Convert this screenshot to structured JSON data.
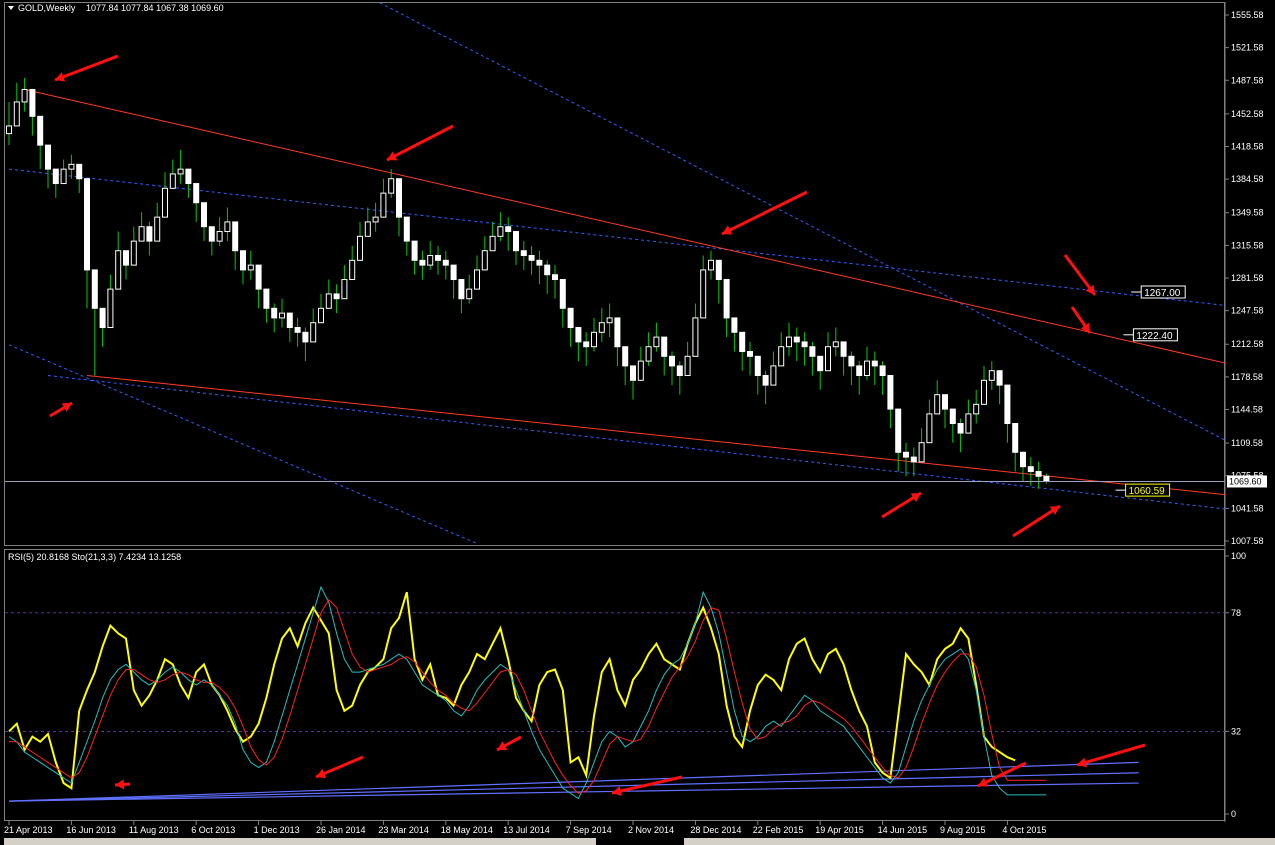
{
  "header": {
    "price_title": "GOLD,Weekly",
    "price_ohlc": "1077.84 1077.84 1067.38 1069.60",
    "osc_title": "RSI(5) 20.8168  Sto(21,3,3) 7.4234 13.1258"
  },
  "colors": {
    "background": "#000000",
    "bull_candle": "#ffffff",
    "bear_candle": "#ffffff",
    "wick": "#00cc00",
    "channel_line": "#ff3b1f",
    "dotted_line": "#3060ff",
    "rsi": "#ffff00",
    "stoch_main": "#20c0c0",
    "stoch_signal": "#ff2020",
    "trend_support": "#6070ff",
    "arrow": "#ff1010",
    "level_line": "#8080ff"
  },
  "chart_data": [
    {
      "type": "candlestick",
      "series_name": "GOLD,Weekly",
      "ylim": [
        1007.58,
        1555.58
      ],
      "y_ticks": [
        "1555.58",
        "1521.58",
        "1487.58",
        "1452.58",
        "1418.58",
        "1384.58",
        "1349.58",
        "1315.58",
        "1281.58",
        "1247.58",
        "1212.58",
        "1178.58",
        "1144.58",
        "1109.58",
        "1075.58",
        "1041.58",
        "1007.58"
      ],
      "y_tick_values": [
        1555.58,
        1521.58,
        1487.58,
        1452.58,
        1418.58,
        1384.58,
        1349.58,
        1315.58,
        1281.58,
        1247.58,
        1212.58,
        1178.58,
        1144.58,
        1109.58,
        1075.58,
        1041.58,
        1007.58
      ],
      "x_ticks": [
        "21 Apr 2013",
        "16 Jun 2013",
        "11 Aug 2013",
        "6 Oct 2013",
        "1 Dec 2013",
        "26 Jan 2014",
        "23 Mar 2014",
        "18 May 2014",
        "13 Jul 2014",
        "7 Sep 2014",
        "2 Nov 2014",
        "28 Dec 2014",
        "22 Feb 2015",
        "19 Apr 2015",
        "14 Jun 2015",
        "9 Aug 2015",
        "4 Oct 2015"
      ],
      "x_tick_index": [
        0,
        8,
        16,
        24,
        32,
        40,
        48,
        56,
        64,
        72,
        80,
        88,
        96,
        104,
        112,
        120,
        128
      ],
      "current_price": 1069.6,
      "current_price_label": "1069.60",
      "level_labels": [
        {
          "text": "1267.00",
          "value": 1267.0,
          "index": 159
        },
        {
          "text": "1222.40",
          "value": 1222.4,
          "index": 158
        },
        {
          "text": "1060.59",
          "value": 1060.59,
          "index": 157
        }
      ],
      "closes": [
        1440,
        1465,
        1478,
        1450,
        1420,
        1395,
        1380,
        1395,
        1400,
        1385,
        1290,
        1250,
        1230,
        1270,
        1310,
        1295,
        1320,
        1335,
        1320,
        1345,
        1375,
        1390,
        1395,
        1380,
        1360,
        1335,
        1320,
        1330,
        1340,
        1310,
        1290,
        1295,
        1270,
        1250,
        1240,
        1245,
        1230,
        1225,
        1215,
        1235,
        1250,
        1265,
        1260,
        1280,
        1300,
        1325,
        1340,
        1345,
        1370,
        1385,
        1345,
        1320,
        1300,
        1295,
        1305,
        1300,
        1295,
        1280,
        1260,
        1270,
        1290,
        1310,
        1325,
        1335,
        1330,
        1310,
        1305,
        1300,
        1295,
        1285,
        1280,
        1250,
        1230,
        1215,
        1210,
        1225,
        1235,
        1240,
        1210,
        1190,
        1175,
        1195,
        1210,
        1220,
        1200,
        1190,
        1180,
        1200,
        1240,
        1290,
        1300,
        1280,
        1240,
        1225,
        1205,
        1200,
        1180,
        1170,
        1190,
        1210,
        1220,
        1215,
        1210,
        1200,
        1185,
        1210,
        1215,
        1200,
        1190,
        1180,
        1195,
        1190,
        1180,
        1145,
        1100,
        1095,
        1090,
        1110,
        1140,
        1160,
        1145,
        1130,
        1120,
        1140,
        1150,
        1175,
        1185,
        1170,
        1130,
        1100,
        1085,
        1080,
        1075,
        1069.6
      ],
      "highs": [
        1465,
        1485,
        1490,
        1470,
        1440,
        1410,
        1395,
        1405,
        1410,
        1400,
        1320,
        1270,
        1245,
        1285,
        1330,
        1310,
        1335,
        1350,
        1340,
        1360,
        1392,
        1405,
        1415,
        1395,
        1375,
        1350,
        1335,
        1345,
        1355,
        1330,
        1305,
        1310,
        1290,
        1270,
        1255,
        1260,
        1245,
        1240,
        1230,
        1250,
        1265,
        1280,
        1275,
        1295,
        1315,
        1340,
        1355,
        1360,
        1385,
        1395,
        1365,
        1335,
        1315,
        1310,
        1320,
        1315,
        1310,
        1295,
        1275,
        1285,
        1305,
        1325,
        1340,
        1350,
        1345,
        1325,
        1320,
        1315,
        1310,
        1300,
        1295,
        1265,
        1245,
        1230,
        1225,
        1240,
        1250,
        1255,
        1225,
        1205,
        1190,
        1210,
        1225,
        1235,
        1215,
        1205,
        1195,
        1215,
        1255,
        1305,
        1310,
        1295,
        1255,
        1240,
        1220,
        1215,
        1195,
        1185,
        1205,
        1225,
        1235,
        1230,
        1225,
        1215,
        1200,
        1225,
        1230,
        1215,
        1205,
        1195,
        1210,
        1205,
        1195,
        1160,
        1115,
        1110,
        1105,
        1125,
        1155,
        1175,
        1160,
        1145,
        1135,
        1155,
        1165,
        1190,
        1195,
        1185,
        1145,
        1115,
        1100,
        1095,
        1090,
        1078
      ],
      "lows": [
        1420,
        1440,
        1455,
        1430,
        1395,
        1375,
        1365,
        1380,
        1385,
        1370,
        1250,
        1180,
        1210,
        1240,
        1290,
        1280,
        1300,
        1320,
        1305,
        1330,
        1360,
        1375,
        1380,
        1365,
        1340,
        1320,
        1305,
        1315,
        1320,
        1290,
        1275,
        1280,
        1250,
        1235,
        1225,
        1230,
        1215,
        1210,
        1195,
        1215,
        1235,
        1250,
        1245,
        1265,
        1285,
        1310,
        1325,
        1330,
        1350,
        1365,
        1325,
        1305,
        1285,
        1280,
        1290,
        1285,
        1280,
        1260,
        1245,
        1255,
        1275,
        1295,
        1310,
        1320,
        1310,
        1295,
        1290,
        1285,
        1275,
        1265,
        1260,
        1230,
        1210,
        1195,
        1190,
        1205,
        1215,
        1220,
        1190,
        1170,
        1155,
        1175,
        1190,
        1205,
        1180,
        1170,
        1160,
        1180,
        1220,
        1270,
        1280,
        1255,
        1220,
        1205,
        1185,
        1180,
        1160,
        1150,
        1170,
        1190,
        1200,
        1195,
        1190,
        1180,
        1165,
        1190,
        1200,
        1180,
        1170,
        1160,
        1175,
        1170,
        1160,
        1125,
        1080,
        1075,
        1075,
        1090,
        1120,
        1140,
        1125,
        1110,
        1100,
        1120,
        1130,
        1155,
        1165,
        1150,
        1110,
        1080,
        1070,
        1065,
        1062,
        1067.38
      ],
      "channel_lines": [
        {
          "from": [
            2,
            1478
          ],
          "to": [
            157,
            1191
          ]
        },
        {
          "from": [
            10,
            1180
          ],
          "to": [
            157,
            1055
          ]
        }
      ],
      "dotted_lines": [
        {
          "from": [
            0,
            1395
          ],
          "to": [
            157,
            1252
          ]
        },
        {
          "from": [
            5,
            1180
          ],
          "to": [
            157,
            1040
          ]
        },
        {
          "from": [
            40,
            1600
          ],
          "to": [
            157,
            1108
          ]
        },
        {
          "from": [
            0,
            1212
          ],
          "to": [
            60,
            1005
          ]
        }
      ]
    },
    {
      "type": "line",
      "series_name": "RSI(5) / Sto(21,3,3)",
      "ylim": [
        0,
        100
      ],
      "y_ticks": [
        "100",
        "78",
        "32",
        "0"
      ],
      "y_tick_values": [
        100,
        78,
        32,
        0
      ],
      "levels": [
        78,
        32
      ],
      "series": [
        {
          "name": "RSI(5)",
          "color_key": "rsi",
          "values": [
            32,
            35,
            25,
            30,
            28,
            31,
            20,
            12,
            10,
            40,
            48,
            55,
            65,
            73,
            70,
            68,
            48,
            42,
            46,
            52,
            60,
            58,
            50,
            45,
            55,
            58,
            50,
            46,
            40,
            33,
            28,
            30,
            35,
            45,
            58,
            68,
            72,
            65,
            74,
            80,
            75,
            70,
            48,
            40,
            42,
            50,
            55,
            57,
            60,
            72,
            76,
            86,
            60,
            52,
            58,
            46,
            45,
            42,
            50,
            55,
            62,
            60,
            66,
            72,
            60,
            45,
            40,
            36,
            50,
            55,
            56,
            48,
            20,
            22,
            15,
            38,
            55,
            60,
            48,
            42,
            52,
            56,
            62,
            66,
            60,
            58,
            56,
            66,
            74,
            80,
            72,
            62,
            42,
            30,
            26,
            40,
            50,
            54,
            52,
            48,
            60,
            66,
            68,
            60,
            55,
            62,
            64,
            58,
            48,
            40,
            34,
            20,
            16,
            14,
            38,
            62,
            58,
            55,
            50,
            60,
            64,
            66,
            72,
            68,
            50,
            30,
            26,
            24,
            22,
            20.8
          ],
          "visible_from_index": 0
        },
        {
          "name": "Sto main",
          "color_key": "stoch_main",
          "values": [
            30,
            28,
            24,
            22,
            20,
            18,
            16,
            14,
            12,
            20,
            28,
            36,
            45,
            52,
            56,
            58,
            55,
            52,
            50,
            52,
            55,
            57,
            55,
            52,
            50,
            52,
            50,
            46,
            42,
            35,
            25,
            20,
            18,
            20,
            28,
            38,
            48,
            58,
            68,
            78,
            88,
            82,
            70,
            60,
            55,
            55,
            56,
            57,
            58,
            60,
            62,
            60,
            55,
            50,
            48,
            46,
            44,
            40,
            38,
            42,
            48,
            52,
            55,
            58,
            56,
            48,
            40,
            32,
            25,
            20,
            15,
            10,
            8,
            6,
            12,
            20,
            28,
            32,
            30,
            26,
            28,
            34,
            40,
            48,
            54,
            58,
            60,
            66,
            74,
            86,
            80,
            70,
            55,
            40,
            30,
            28,
            30,
            34,
            36,
            34,
            38,
            42,
            46,
            44,
            40,
            38,
            36,
            34,
            30,
            26,
            22,
            18,
            14,
            12,
            16,
            26,
            36,
            44,
            50,
            56,
            60,
            62,
            64,
            60,
            48,
            30,
            15,
            10,
            7.4,
            7.4,
            7.4,
            7.4,
            7.4,
            7.4
          ]
        },
        {
          "name": "Sto signal",
          "color_key": "stoch_signal",
          "values": [
            28,
            28,
            26,
            24,
            22,
            20,
            18,
            16,
            14,
            16,
            22,
            30,
            38,
            46,
            52,
            56,
            56,
            54,
            52,
            51,
            52,
            54,
            55,
            54,
            52,
            51,
            51,
            49,
            46,
            41,
            34,
            26,
            21,
            19,
            22,
            29,
            38,
            48,
            58,
            68,
            78,
            83,
            80,
            71,
            62,
            57,
            55,
            56,
            57,
            58,
            60,
            61,
            59,
            55,
            51,
            48,
            46,
            43,
            41,
            40,
            43,
            47,
            51,
            55,
            56,
            54,
            48,
            40,
            32,
            26,
            20,
            15,
            11,
            8,
            9,
            13,
            20,
            27,
            30,
            29,
            28,
            29,
            34,
            41,
            47,
            53,
            57,
            61,
            67,
            75,
            80,
            79,
            68,
            55,
            43,
            33,
            29,
            30,
            33,
            35,
            36,
            38,
            42,
            44,
            43,
            41,
            39,
            37,
            34,
            30,
            26,
            22,
            18,
            15,
            14,
            18,
            26,
            35,
            43,
            50,
            55,
            59,
            62,
            62,
            57,
            46,
            31,
            18,
            13.1,
            13.1,
            13.1,
            13.1,
            13.1,
            13.1
          ]
        }
      ],
      "trend_lines": [
        {
          "from": [
            0,
            5
          ],
          "to": [
            157,
            16
          ]
        },
        {
          "from": [
            0,
            5
          ],
          "to": [
            157,
            12
          ]
        },
        {
          "from": [
            0,
            5
          ],
          "to": [
            157,
            20
          ]
        }
      ]
    }
  ],
  "arrows": [
    {
      "from": [
        118,
        56
      ],
      "to": [
        55,
        80
      ]
    },
    {
      "from": [
        453,
        126
      ],
      "to": [
        387,
        160
      ]
    },
    {
      "from": [
        807,
        192
      ],
      "to": [
        722,
        234
      ]
    },
    {
      "from": [
        1065,
        255
      ],
      "to": [
        1095,
        295
      ]
    },
    {
      "from": [
        1072,
        307
      ],
      "to": [
        1090,
        333
      ]
    },
    {
      "from": [
        50,
        416
      ],
      "to": [
        72,
        403
      ]
    },
    {
      "from": [
        882,
        517
      ],
      "to": [
        921,
        493
      ]
    },
    {
      "from": [
        1013,
        536
      ],
      "to": [
        1060,
        506
      ]
    },
    {
      "from": [
        130,
        784
      ],
      "to": [
        115,
        785
      ]
    },
    {
      "from": [
        363,
        757
      ],
      "to": [
        316,
        777
      ]
    },
    {
      "from": [
        521,
        737
      ],
      "to": [
        497,
        750
      ]
    },
    {
      "from": [
        682,
        777
      ],
      "to": [
        612,
        793
      ]
    },
    {
      "from": [
        1026,
        763
      ],
      "to": [
        978,
        786
      ]
    },
    {
      "from": [
        1145,
        745
      ],
      "to": [
        1077,
        765
      ]
    }
  ]
}
